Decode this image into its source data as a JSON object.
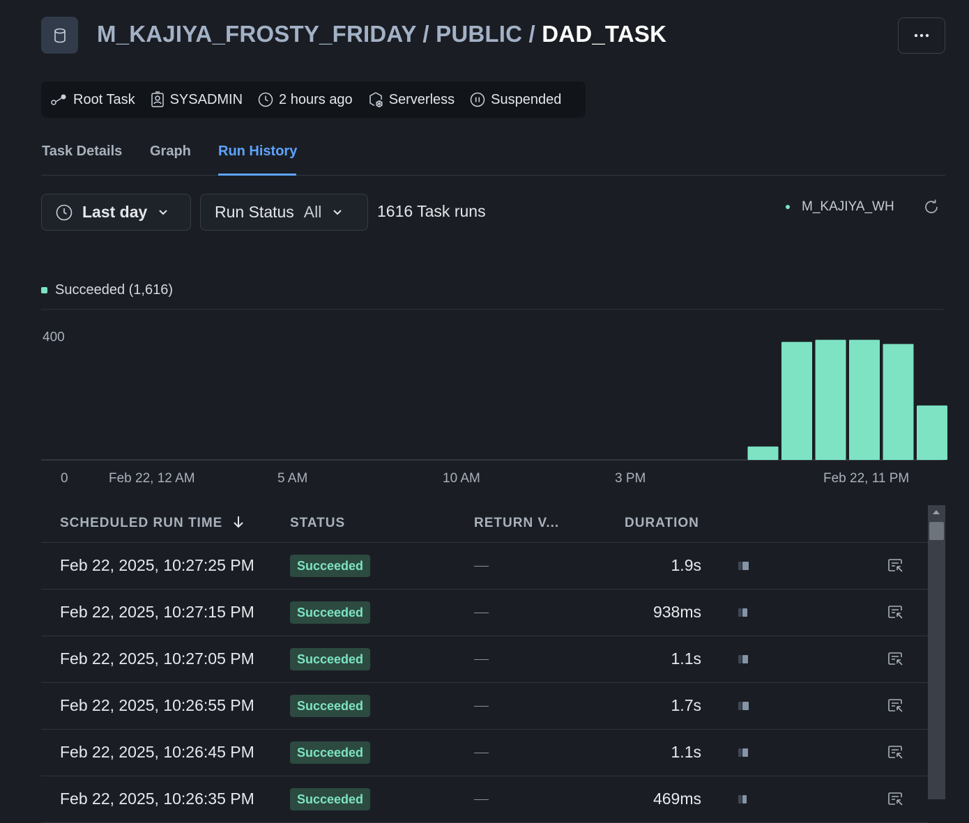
{
  "header": {
    "database": "M_KAJIYA_FROSTY_FRIDAY",
    "sep1": " / ",
    "schema": "PUBLIC",
    "sep2": " / ",
    "task": "DAD_TASK"
  },
  "meta": {
    "type": "Root Task",
    "owner": "SYSADMIN",
    "modified": "2 hours ago",
    "compute": "Serverless",
    "state": "Suspended"
  },
  "tabs": [
    {
      "label": "Task Details",
      "active": false
    },
    {
      "label": "Graph",
      "active": false
    },
    {
      "label": "Run History",
      "active": true
    }
  ],
  "filters": {
    "time_range": "Last day",
    "run_status_label": "Run Status",
    "run_status_value": "All",
    "task_runs": "1616 Task runs",
    "warehouse": "M_KAJIYA_WH"
  },
  "chart_data": {
    "type": "bar",
    "legend": [
      {
        "name": "Succeeded (1,616)",
        "color": "#7de3c3"
      }
    ],
    "y_ticks": [
      "0",
      "400"
    ],
    "ylim": [
      0,
      450
    ],
    "x_tick_labels": [
      "Feb 22, 12 AM",
      "5 AM",
      "10 AM",
      "3 PM",
      "Feb 22, 11 PM"
    ],
    "hours": 24,
    "values": [
      0,
      0,
      0,
      0,
      0,
      0,
      0,
      0,
      0,
      0,
      0,
      0,
      0,
      0,
      0,
      0,
      0,
      0,
      0,
      45,
      397,
      404,
      404,
      390,
      183,
      0
    ],
    "color": "#7de3c3"
  },
  "table": {
    "columns": [
      "SCHEDULED RUN TIME",
      "STATUS",
      "RETURN V...",
      "DURATION"
    ],
    "rows": [
      {
        "time": "Feb 22, 2025, 10:27:25 PM",
        "status": "Succeeded",
        "ret": "—",
        "duration": "1.9s"
      },
      {
        "time": "Feb 22, 2025, 10:27:15 PM",
        "status": "Succeeded",
        "ret": "—",
        "duration": "938ms"
      },
      {
        "time": "Feb 22, 2025, 10:27:05 PM",
        "status": "Succeeded",
        "ret": "—",
        "duration": "1.1s"
      },
      {
        "time": "Feb 22, 2025, 10:26:55 PM",
        "status": "Succeeded",
        "ret": "—",
        "duration": "1.7s"
      },
      {
        "time": "Feb 22, 2025, 10:26:45 PM",
        "status": "Succeeded",
        "ret": "—",
        "duration": "1.1s"
      },
      {
        "time": "Feb 22, 2025, 10:26:35 PM",
        "status": "Succeeded",
        "ret": "—",
        "duration": "469ms"
      }
    ]
  }
}
